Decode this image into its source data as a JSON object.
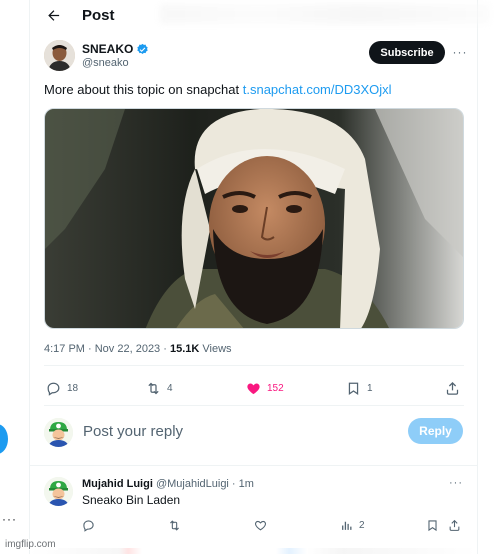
{
  "header": {
    "title": "Post"
  },
  "author": {
    "name": "SNEAKO",
    "handle": "@sneako",
    "subscribe_label": "Subscribe",
    "more_label": "···"
  },
  "post": {
    "text": "More about this topic on snapchat ",
    "link": "t.snapchat.com/DD3XOjxl",
    "time": "4:17 PM · Nov 22, 2023 · ",
    "views_count": "15.1K",
    "views_label": " Views"
  },
  "actions": {
    "replies": "18",
    "reposts": "4",
    "likes": "152",
    "bookmarks": "1"
  },
  "reply_box": {
    "placeholder": "Post your reply",
    "button_label": "Reply"
  },
  "comment": {
    "name": "Mujahid Luigi",
    "meta": " @MujahidLuigi · 1m",
    "text": "Sneako Bin Laden",
    "more_label": "···",
    "views": "2"
  },
  "sidebar": {
    "more_label": "···"
  },
  "watermark": "imgflip.com",
  "colors": {
    "accent": "#1d9bf0",
    "like": "#f91880",
    "text_secondary": "#536471",
    "reply_button_disabled": "#8ecdf8"
  },
  "icons": {
    "back": "arrow-left-icon",
    "verified": "verified-badge-icon",
    "reply": "reply-icon",
    "repost": "repost-icon",
    "like": "heart-filled-icon",
    "bookmark": "bookmark-icon",
    "share": "share-icon",
    "views": "analytics-icon"
  }
}
